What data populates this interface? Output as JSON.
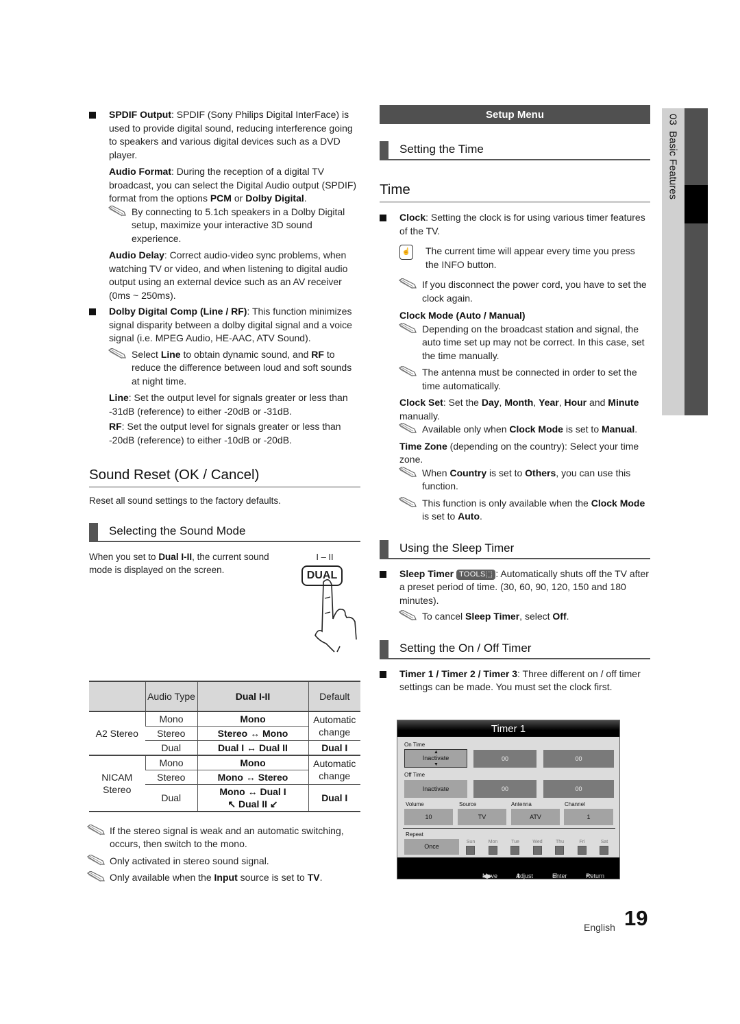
{
  "left": {
    "spdif": {
      "term": "SPDIF Output",
      "text": ": SPDIF (Sony Philips Digital InterFace) is used to provide digital sound, reducing interference going to speakers and various digital devices such as a DVD player."
    },
    "audio_format": {
      "term": "Audio Format",
      "text1": ": During the reception of a digital TV broadcast, you can select the Digital Audio output (SPDIF) format from the options ",
      "opt1": "PCM",
      "or": " or ",
      "opt2": "Dolby Digital",
      "end": "."
    },
    "note_51": "By connecting to 5.1ch speakers in a Dolby Digital setup, maximize your interactive 3D sound experience.",
    "audio_delay": {
      "term": "Audio Delay",
      "text": ": Correct audio-video sync problems, when watching TV or video, and when listening to digital audio output using an external device such as an AV receiver (0ms ~ 250ms)."
    },
    "dolby_comp": {
      "term": "Dolby Digital Comp (Line / RF)",
      "text": ": This function minimizes signal disparity between a dolby digital signal and a voice signal (i.e. MPEG Audio, HE-AAC, ATV Sound)."
    },
    "note_line_rf": {
      "pre": "Select ",
      "t1": "Line",
      "mid": " to obtain dynamic sound, and ",
      "t2": "RF",
      "post": " to reduce the difference between loud and soft sounds at night time."
    },
    "line": {
      "term": "Line",
      "text": ": Set the output level for signals greater or less than -31dB (reference) to either -20dB or -31dB."
    },
    "rf": {
      "term": "RF",
      "text": ": Set the output level for signals greater or less than -20dB (reference) to either -10dB or -20dB."
    },
    "sound_reset_title": "Sound Reset (OK / Cancel)",
    "sound_reset_desc": "Reset all sound settings to the factory defaults.",
    "sound_mode_title": "Selecting the Sound Mode",
    "sound_mode_desc": {
      "pre": "When you set to ",
      "term": "Dual I-II",
      "post": ", the current sound mode is displayed on the screen."
    },
    "remote_button": {
      "top_label": "I – II",
      "label": "DUAL"
    },
    "table": {
      "headers": [
        "",
        "Audio Type",
        "Dual I-II",
        "Default"
      ],
      "groups": [
        {
          "name": "A2 Stereo",
          "rows": [
            {
              "type": "Mono",
              "dual": "Mono",
              "default": "Automatic change"
            },
            {
              "type": "Stereo",
              "dual": "Stereo ↔ Mono",
              "default": ""
            },
            {
              "type": "Dual",
              "dual": "Dual I ↔ Dual II",
              "default": "Dual I"
            }
          ]
        },
        {
          "name": "NICAM Stereo",
          "rows": [
            {
              "type": "Mono",
              "dual": "Mono",
              "default": "Automatic change"
            },
            {
              "type": "Stereo",
              "dual": "Mono ↔ Stereo",
              "default": ""
            },
            {
              "type": "Dual",
              "dual": "Mono ↔ Dual I",
              "dual2": "↖ Dual II ↙",
              "default": "Dual I"
            }
          ]
        }
      ]
    },
    "notes_after_table": [
      "If the stereo signal is weak and an automatic switching, occurs, then switch to the mono.",
      "Only activated in stereo sound signal."
    ],
    "note_input": {
      "pre": "Only available when the ",
      "t1": "Input",
      "mid": " source is set to ",
      "t2": "TV",
      "post": "."
    }
  },
  "right": {
    "setup_menu": "Setup Menu",
    "setting_time_title": "Setting the Time",
    "time_title": "Time",
    "clock": {
      "term": "Clock",
      "text": ": Setting the clock is for using various timer features of the TV."
    },
    "info_note": {
      "pre": "The current time will appear every time you press the ",
      "t1": "INFO",
      "post": " button."
    },
    "power_note": "If you disconnect the power cord, you have to set the clock again.",
    "clock_mode": "Clock Mode (Auto / Manual)",
    "clock_mode_notes": [
      "Depending on the broadcast station and signal, the auto time set up may not be correct. In this case, set the time manually.",
      "The antenna must be connected in order to set the time automatically."
    ],
    "clock_set": {
      "term": "Clock Set",
      "pre": ": Set the ",
      "day": "Day",
      "month": "Month",
      "year": "Year",
      "hour": "Hour",
      "minute": "Minute",
      "sep": ", ",
      "and": " and ",
      "post": " manually."
    },
    "clock_set_note": {
      "pre": "Available only when ",
      "t1": "Clock Mode",
      "mid": " is set to ",
      "t2": "Manual",
      "post": "."
    },
    "time_zone": {
      "term": "Time Zone",
      "text": " (depending on the country): Select your time zone."
    },
    "tz_note1": {
      "pre": "When ",
      "t1": "Country",
      "mid": " is set to ",
      "t2": "Others",
      "post": ", you can use this function."
    },
    "tz_note2": {
      "pre": "This function is only available when the ",
      "t1": "Clock Mode",
      "mid": " is set to ",
      "t2": "Auto",
      "post": "."
    },
    "sleep_title": "Using the Sleep Timer",
    "sleep": {
      "term": "Sleep Timer",
      "chip": "TOOLS",
      "text": ": Automatically shuts off the TV after a preset period of time. (30, 60, 90, 120, 150 and 180 minutes)."
    },
    "sleep_note": {
      "pre": "To cancel ",
      "t1": "Sleep Timer",
      "mid": ", select ",
      "t2": "Off",
      "post": "."
    },
    "onoff_title": "Setting the On / Off Timer",
    "timer_desc": {
      "term": "Timer 1 / Timer 2 / Timer 3",
      "text": ": Three different on / off timer settings can be made. You must set the clock first."
    },
    "timer_osd": {
      "title": "Timer 1",
      "on_time_label": "On Time",
      "on_time": [
        "Inactivate",
        "00",
        "00"
      ],
      "off_time_label": "Off Time",
      "off_time": [
        "Inactivate",
        "00",
        "00"
      ],
      "volume_label": "Volume",
      "volume": "10",
      "source_label": "Source",
      "source": "TV",
      "antenna_label": "Antenna",
      "antenna": "ATV",
      "channel_label": "Channel",
      "channel": "1",
      "repeat_label": "Repeat",
      "repeat": "Once",
      "days": [
        "Sun",
        "Mon",
        "Tue",
        "Wed",
        "Thu",
        "Fri",
        "Sat"
      ],
      "footer": {
        "move": "Move",
        "adjust": "Adjust",
        "enter": "Enter",
        "return": "Return"
      }
    }
  },
  "side_tab": {
    "label": "03  Basic Features"
  },
  "footer": {
    "language": "English",
    "page_number": "19"
  }
}
